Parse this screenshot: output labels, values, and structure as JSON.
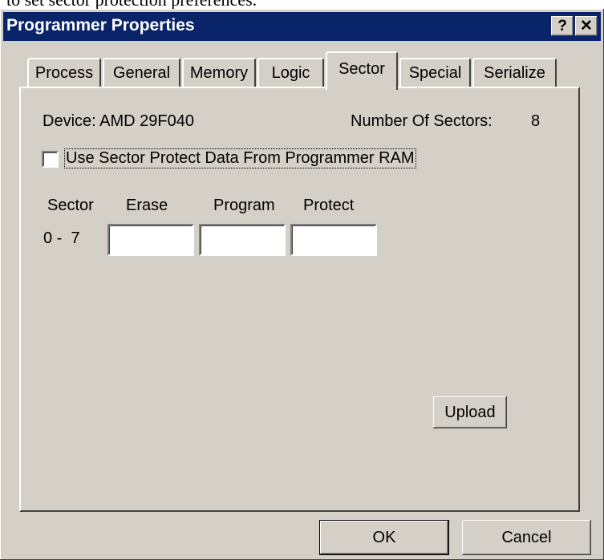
{
  "caption": "to set sector protection preferences.",
  "window": {
    "title": "Programmer Properties",
    "help_label": "?",
    "close_label": "✕"
  },
  "tabs": [
    {
      "label": "Process",
      "active": false
    },
    {
      "label": "General",
      "active": false
    },
    {
      "label": "Memory",
      "active": false
    },
    {
      "label": "Logic",
      "active": false
    },
    {
      "label": "Sector",
      "active": true
    },
    {
      "label": "Special",
      "active": false
    },
    {
      "label": "Serialize",
      "active": false
    }
  ],
  "sector_page": {
    "device_label": "Device: AMD 29F040",
    "num_sectors_label": "Number Of Sectors:",
    "num_sectors_value": "8",
    "use_ram_checkbox": {
      "label": "Use Sector Protect Data From Programmer RAM",
      "checked": false
    },
    "table": {
      "headers": {
        "sector": "Sector",
        "erase": "Erase",
        "program": "Program",
        "protect": "Protect"
      },
      "rows": [
        {
          "range": "0 -  7",
          "erase": "",
          "program": "",
          "protect": ""
        }
      ]
    },
    "upload_label": "Upload"
  },
  "footer": {
    "ok_label": "OK",
    "cancel_label": "Cancel"
  }
}
